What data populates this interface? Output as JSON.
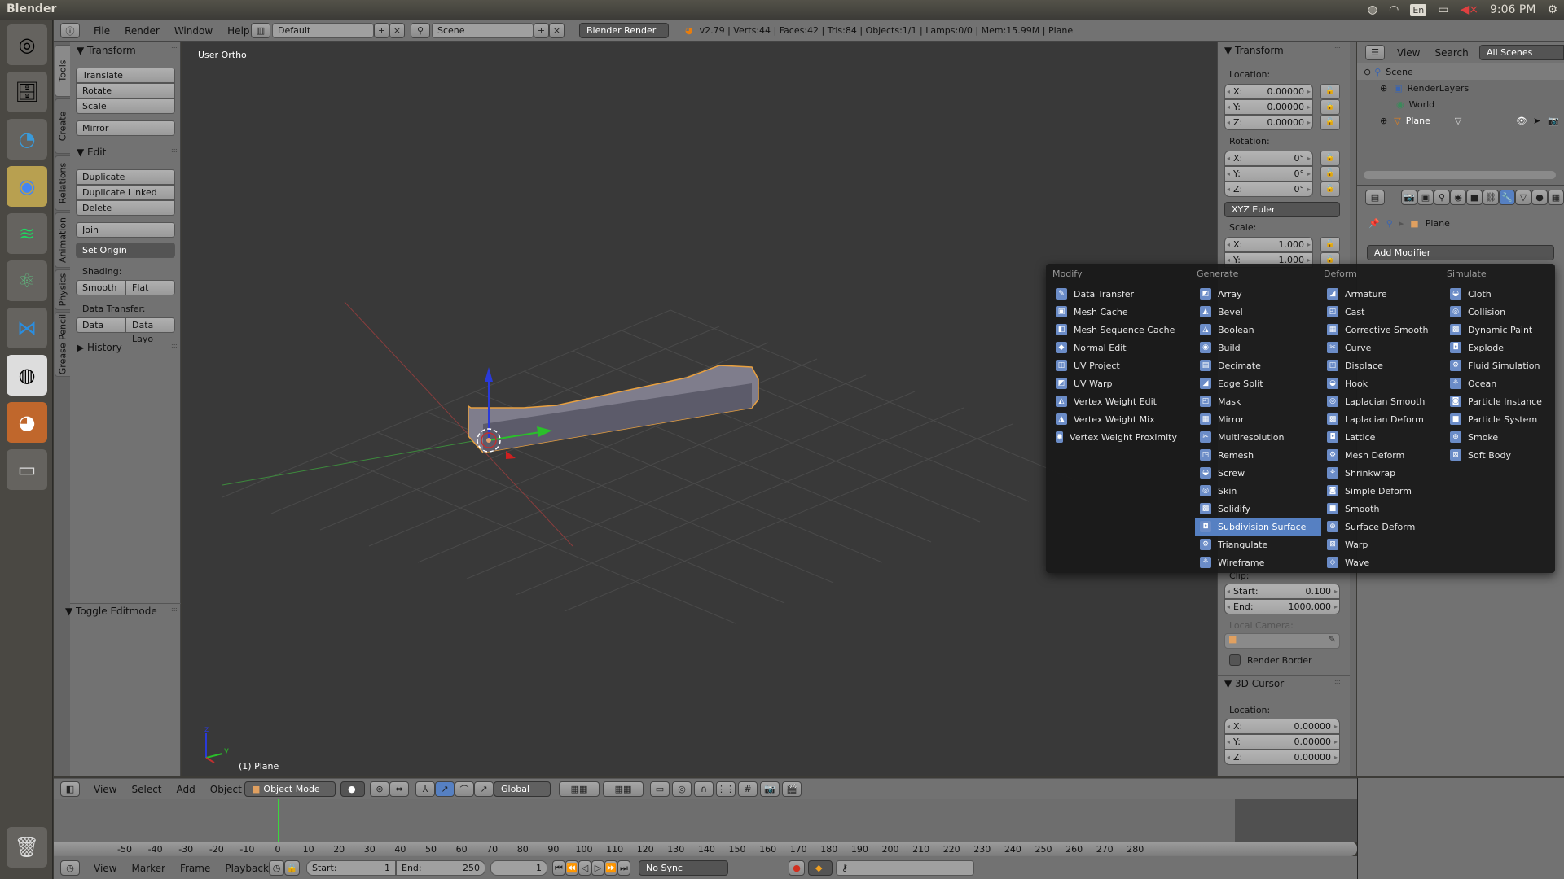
{
  "os": {
    "window_title": "Blender",
    "tray": {
      "language": "En",
      "time": "9:06 PM"
    },
    "launcher": [
      {
        "name": "ubuntu-dash",
        "glyph": "◎"
      },
      {
        "name": "files",
        "glyph": "🗄"
      },
      {
        "name": "shutter",
        "glyph": "◔"
      },
      {
        "name": "chrome",
        "glyph": "◉"
      },
      {
        "name": "spotify",
        "glyph": "≋"
      },
      {
        "name": "atom",
        "glyph": "⚛"
      },
      {
        "name": "vscode",
        "glyph": "⋈"
      },
      {
        "name": "obs",
        "glyph": "◍"
      },
      {
        "name": "blender",
        "glyph": "◕"
      },
      {
        "name": "disk",
        "glyph": "▭"
      },
      {
        "name": "trash",
        "glyph": "🗑"
      }
    ]
  },
  "info_header": {
    "menus": [
      "File",
      "Render",
      "Window",
      "Help"
    ],
    "layout": "Default",
    "scene": "Scene",
    "engine": "Blender Render",
    "stats": "v2.79 | Verts:44 | Faces:42 | Tris:84 | Objects:1/1 | Lamps:0/0 | Mem:15.99M | Plane"
  },
  "tool_tabs": [
    "Tools",
    "Create",
    "Relations",
    "Animation",
    "Physics",
    "Grease Pencil"
  ],
  "tool_shelf": {
    "transform_title": "Transform",
    "translate": "Translate",
    "rotate": "Rotate",
    "scale": "Scale",
    "mirror": "Mirror",
    "edit_title": "Edit",
    "duplicate": "Duplicate",
    "duplicate_linked": "Duplicate Linked",
    "delete": "Delete",
    "join": "Join",
    "set_origin": "Set Origin",
    "shading_label": "Shading:",
    "smooth": "Smooth",
    "flat": "Flat",
    "data_transfer_label": "Data Transfer:",
    "data": "Data",
    "data_layout": "Data Layo",
    "history_title": "History",
    "toggle_editmode": "Toggle Editmode"
  },
  "viewport": {
    "view_name": "User Ortho",
    "object_label": "(1) Plane"
  },
  "n_panel": {
    "transform_title": "Transform",
    "location_label": "Location:",
    "location": [
      {
        "axis": "X:",
        "value": "0.00000"
      },
      {
        "axis": "Y:",
        "value": "0.00000"
      },
      {
        "axis": "Z:",
        "value": "0.00000"
      }
    ],
    "rotation_label": "Rotation:",
    "rotation": [
      {
        "axis": "X:",
        "value": "0°"
      },
      {
        "axis": "Y:",
        "value": "0°"
      },
      {
        "axis": "Z:",
        "value": "0°"
      }
    ],
    "rotation_mode": "XYZ Euler",
    "scale_label": "Scale:",
    "scale": [
      {
        "axis": "X:",
        "value": "1.000"
      },
      {
        "axis": "Y:",
        "value": "1.000"
      }
    ],
    "clip_label": "Clip:",
    "clip_start": {
      "label": "Start:",
      "value": "0.100"
    },
    "clip_end": {
      "label": "End:",
      "value": "1000.000"
    },
    "local_camera_label": "Local Camera:",
    "render_border": "Render Border",
    "cursor_title": "3D Cursor",
    "cursor_location_label": "Location:",
    "cursor_location": [
      {
        "axis": "X:",
        "value": "0.00000"
      },
      {
        "axis": "Y:",
        "value": "0.00000"
      },
      {
        "axis": "Z:",
        "value": "0.00000"
      }
    ]
  },
  "outliner": {
    "view": "View",
    "search": "Search",
    "filter": "All Scenes",
    "rows": [
      "Scene",
      "RenderLayers",
      "World",
      "Plane"
    ]
  },
  "properties": {
    "breadcrumb_object": "Plane",
    "add_modifier": "Add Modifier"
  },
  "modifier_menu": {
    "columns": [
      {
        "title": "Modify",
        "items": [
          "Data Transfer",
          "Mesh Cache",
          "Mesh Sequence Cache",
          "Normal Edit",
          "UV Project",
          "UV Warp",
          "Vertex Weight Edit",
          "Vertex Weight Mix",
          "Vertex Weight Proximity"
        ]
      },
      {
        "title": "Generate",
        "items": [
          "Array",
          "Bevel",
          "Boolean",
          "Build",
          "Decimate",
          "Edge Split",
          "Mask",
          "Mirror",
          "Multiresolution",
          "Remesh",
          "Screw",
          "Skin",
          "Solidify",
          "Subdivision Surface",
          "Triangulate",
          "Wireframe"
        ]
      },
      {
        "title": "Deform",
        "items": [
          "Armature",
          "Cast",
          "Corrective Smooth",
          "Curve",
          "Displace",
          "Hook",
          "Laplacian Smooth",
          "Laplacian Deform",
          "Lattice",
          "Mesh Deform",
          "Shrinkwrap",
          "Simple Deform",
          "Smooth",
          "Surface Deform",
          "Warp",
          "Wave"
        ]
      },
      {
        "title": "Simulate",
        "items": [
          "Cloth",
          "Collision",
          "Dynamic Paint",
          "Explode",
          "Fluid Simulation",
          "Ocean",
          "Particle Instance",
          "Particle System",
          "Smoke",
          "Soft Body"
        ]
      }
    ],
    "highlighted": "Subdivision Surface"
  },
  "view3d_header": {
    "menus": [
      "View",
      "Select",
      "Add",
      "Object"
    ],
    "mode": "Object Mode",
    "orientation": "Global"
  },
  "timeline": {
    "ticks": [
      "-50",
      "-40",
      "-30",
      "-20",
      "-10",
      "0",
      "10",
      "20",
      "30",
      "40",
      "50",
      "60",
      "70",
      "80",
      "90",
      "100",
      "110",
      "120",
      "130",
      "140",
      "150",
      "160",
      "170",
      "180",
      "190",
      "200",
      "210",
      "220",
      "230",
      "240",
      "250",
      "260",
      "270",
      "280"
    ],
    "menus": [
      "View",
      "Marker",
      "Frame",
      "Playback"
    ],
    "start_label": "Start:",
    "start": "1",
    "end_label": "End:",
    "end": "250",
    "current_frame": "1",
    "sync": "No Sync"
  }
}
